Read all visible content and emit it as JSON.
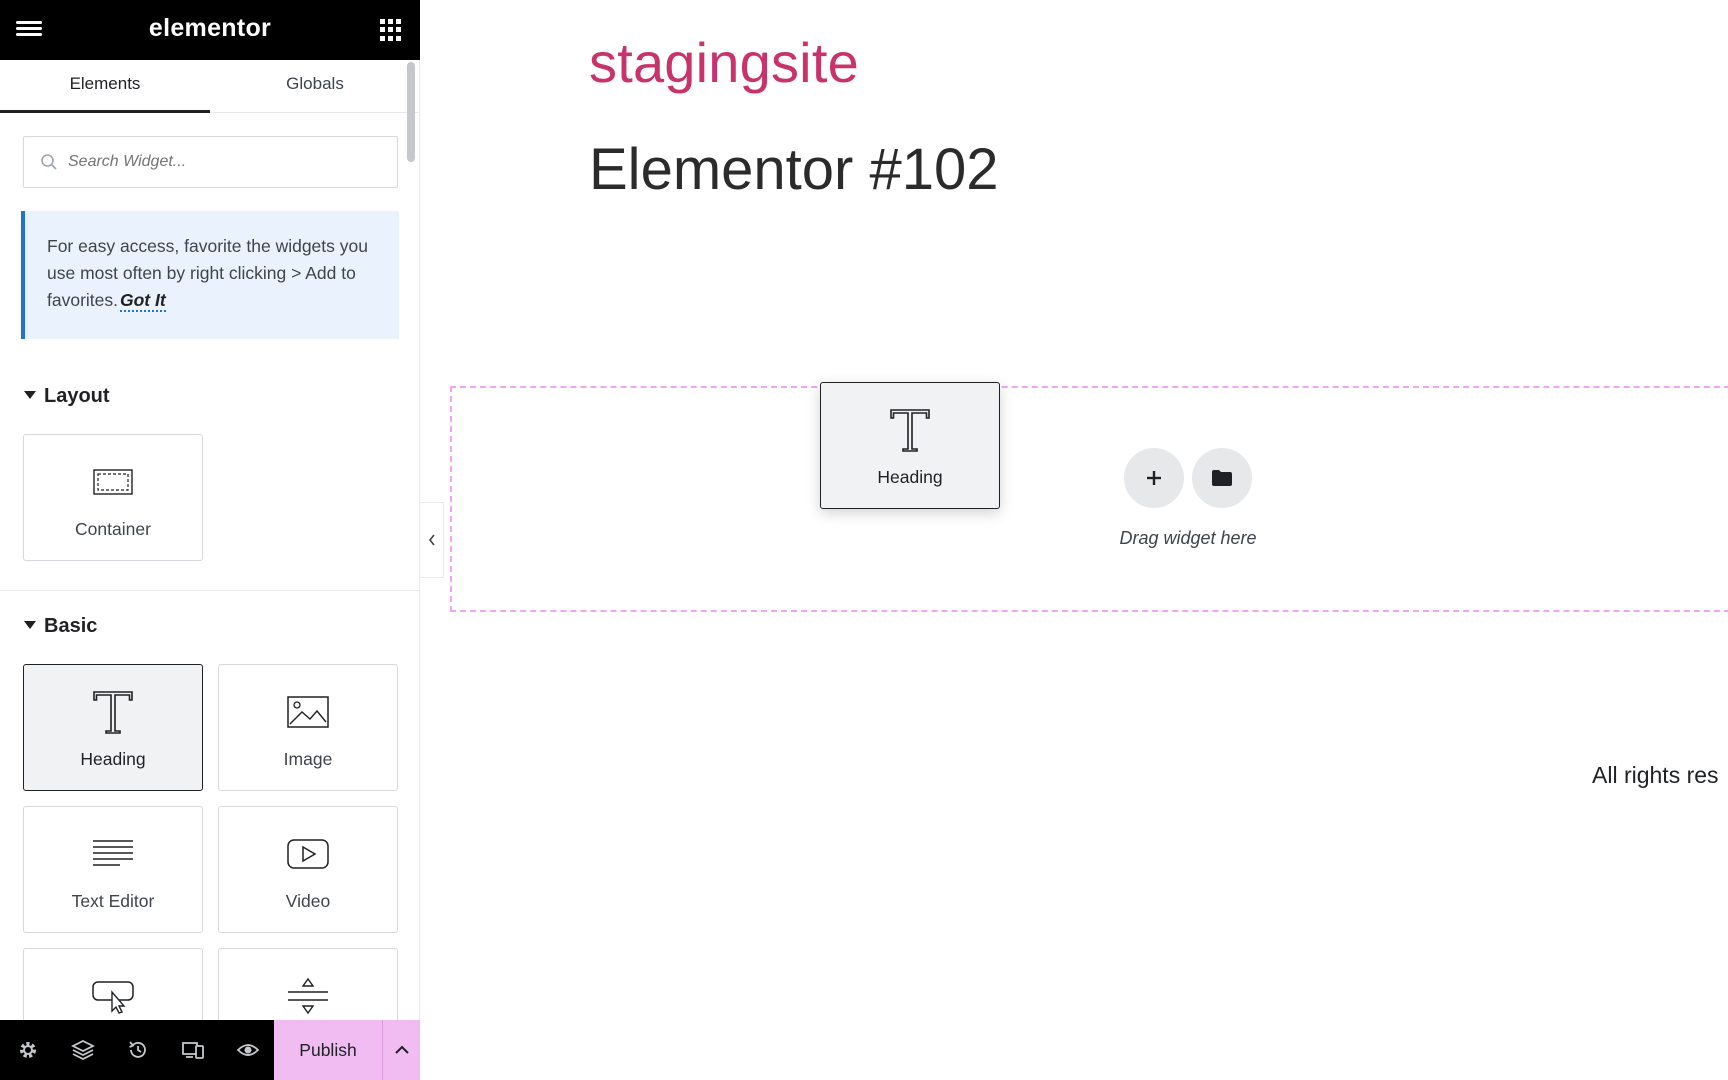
{
  "panel": {
    "logo": "elementor",
    "tabs": [
      {
        "label": "Elements",
        "active": true
      },
      {
        "label": "Globals",
        "active": false
      }
    ],
    "search": {
      "placeholder": "Search Widget...",
      "value": ""
    },
    "notice": {
      "text": "For easy access, favorite the widgets you use most often by right clicking > Add to favorites.",
      "link": "Got It"
    },
    "sections": [
      {
        "title": "Layout",
        "widgets": [
          {
            "label": "Container",
            "icon": "container-icon"
          }
        ]
      },
      {
        "title": "Basic",
        "widgets": [
          {
            "label": "Heading",
            "icon": "heading-icon",
            "selected": true
          },
          {
            "label": "Image",
            "icon": "image-icon"
          },
          {
            "label": "Text Editor",
            "icon": "text-editor-icon"
          },
          {
            "label": "Video",
            "icon": "video-icon"
          },
          {
            "label": "",
            "icon": "button-icon"
          },
          {
            "label": "",
            "icon": "divider-icon"
          }
        ]
      }
    ],
    "footer": {
      "icons": [
        "settings-icon",
        "layers-icon",
        "history-icon",
        "responsive-icon",
        "preview-icon"
      ],
      "publish_label": "Publish"
    }
  },
  "canvas": {
    "site_title": "stagingsite",
    "page_title": "Elementor #102",
    "dropzone_text": "Drag widget here",
    "drag_ghost_label": "Heading",
    "footer_text": "All rights res"
  },
  "colors": {
    "site_title": "#c8336b",
    "publish_bg": "#f0bcf2",
    "dropzone_border": "#f0a6f3",
    "notice_bg": "#eaf3fd",
    "notice_accent": "#2271d3"
  }
}
